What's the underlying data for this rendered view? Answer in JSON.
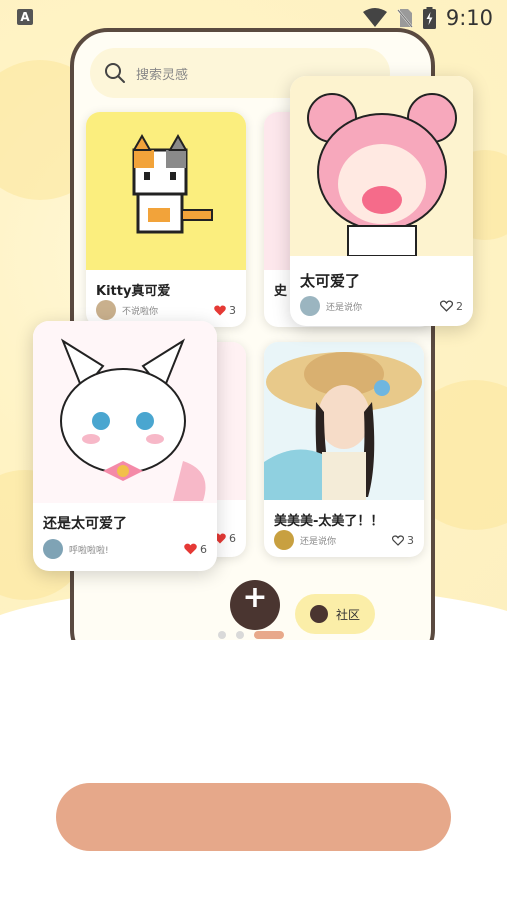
{
  "status_bar": {
    "app_indicator": "A",
    "time": "9:10",
    "icons": [
      "wifi-icon",
      "no-sim-icon",
      "battery-charging-icon"
    ]
  },
  "search": {
    "placeholder": "搜索灵感",
    "icon": "search-icon"
  },
  "feed_cards": [
    {
      "title": "Kitty真可爱",
      "author": "不说啦你",
      "likes": "3",
      "liked": true,
      "image": "pixel-calico-cat"
    },
    {
      "title": "史",
      "image": "partial-card"
    },
    {
      "title": "美美美-太美了！！",
      "author": "还是说你",
      "likes": "3",
      "liked": false,
      "image": "girl-straw-hat"
    },
    {
      "likes": "6",
      "liked": true,
      "image": "partial-card"
    }
  ],
  "floating_cards": [
    {
      "title": "太可爱了",
      "author": "还是说你",
      "likes": "2",
      "liked": false,
      "image": "pixel-pink-hair-girl"
    },
    {
      "title": "还是太可爱了",
      "author": "呼啦啦啦!",
      "likes": "6",
      "liked": true,
      "image": "pixel-white-kitten"
    }
  ],
  "bottom_nav": {
    "add_button": "+",
    "community_label": "社区"
  },
  "pager": {
    "total": 3,
    "active_index": 2
  },
  "cta": {
    "label": ""
  },
  "colors": {
    "background": "#fff3c4",
    "accent": "#e6a88a",
    "like_red": "#e53935",
    "dark_brown": "#4a3530",
    "community_bg": "#fbeea8"
  }
}
